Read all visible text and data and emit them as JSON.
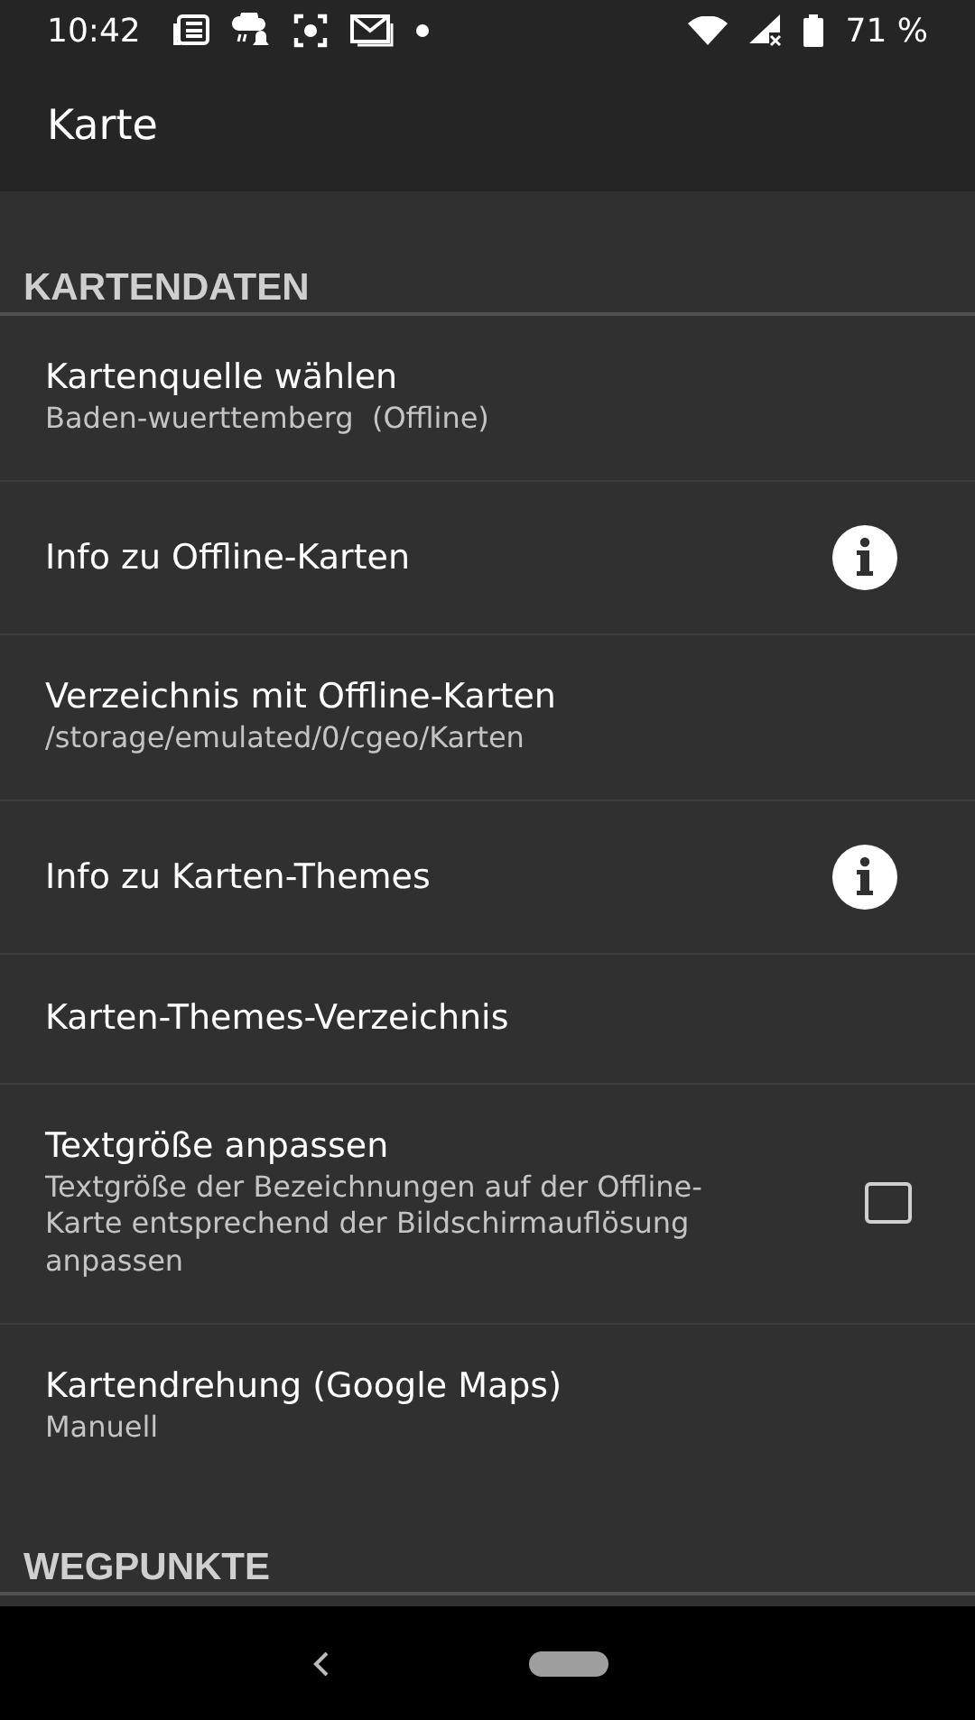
{
  "status_bar": {
    "time": "10:42",
    "battery": "71 %"
  },
  "app_bar": {
    "title": "Karte"
  },
  "sections": [
    {
      "header": "KARTENDATEN",
      "items": [
        {
          "kind": "plain",
          "title": "Kartenquelle wählen",
          "summary": "Baden-wuerttemberg  (Offline)"
        },
        {
          "kind": "info",
          "title": "Info zu Offline-Karten"
        },
        {
          "kind": "plain",
          "title": "Verzeichnis mit Offline-Karten",
          "summary": "/storage/emulated/0/cgeo/Karten"
        },
        {
          "kind": "info",
          "title": "Info zu Karten-Themes"
        },
        {
          "kind": "plain",
          "title": "Karten-Themes-Verzeichnis"
        },
        {
          "kind": "checkbox",
          "title": "Textgröße anpassen",
          "summary": "Textgröße der Bezeichnungen auf der Offline-Karte entsprechend der Bildschirmauflösung anpassen",
          "checked": false
        },
        {
          "kind": "plain",
          "title": "Kartendrehung (Google Maps)",
          "summary": "Manuell"
        }
      ]
    },
    {
      "header": "WEGPUNKTE"
    }
  ]
}
